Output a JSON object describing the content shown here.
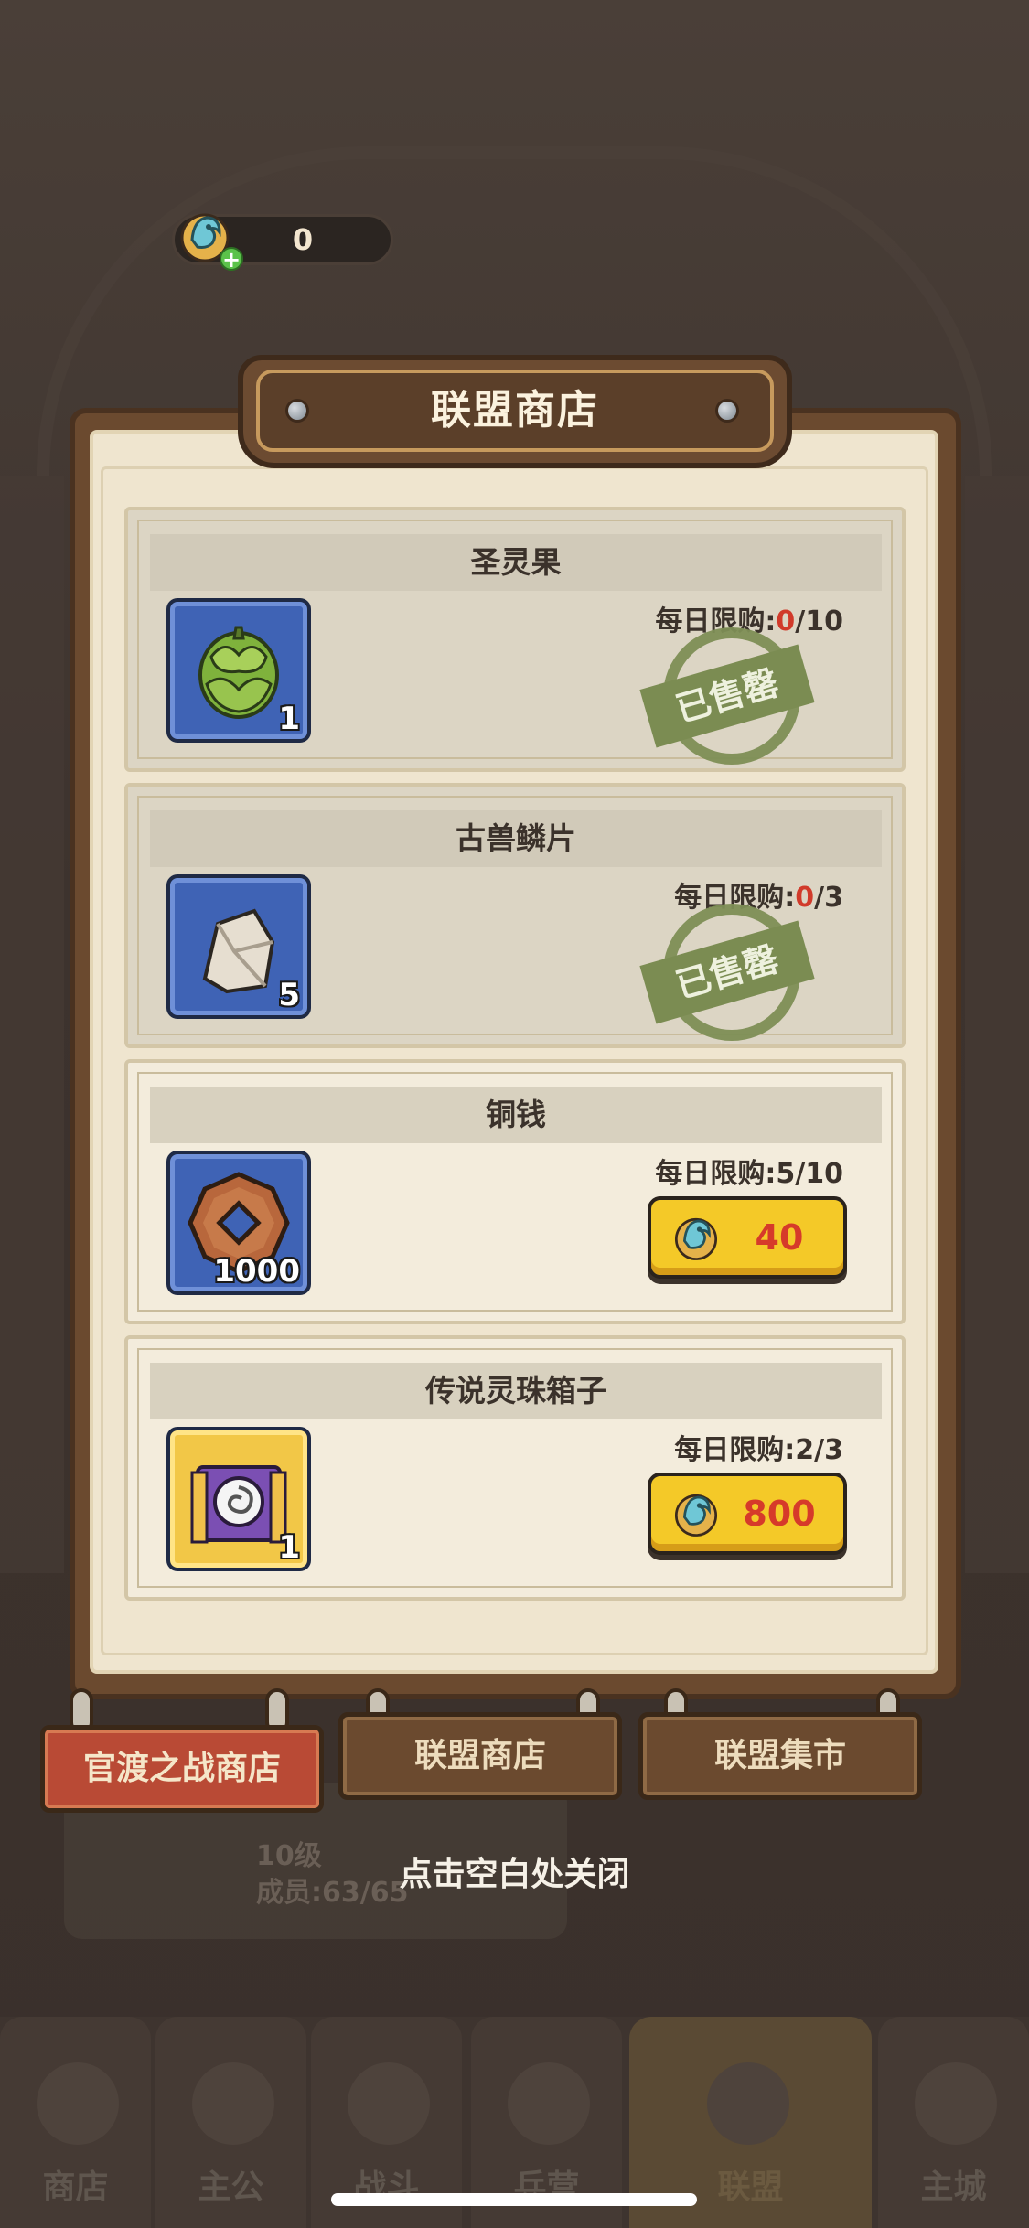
{
  "currency": {
    "value": "0",
    "icon": "dragon-coin-icon"
  },
  "panel": {
    "title": "联盟商店"
  },
  "items": [
    {
      "name": "圣灵果",
      "qty": "1",
      "limit_prefix": "每日限购:",
      "limit_bought": "0",
      "limit_total": "/10",
      "status": "已售罄",
      "icon": "spirit-fruit-icon"
    },
    {
      "name": "古兽鳞片",
      "qty": "5",
      "limit_prefix": "每日限购:",
      "limit_bought": "0",
      "limit_total": "/3",
      "status": "已售罄",
      "icon": "beast-scale-icon"
    },
    {
      "name": "铜钱",
      "qty": "1000",
      "limit": "每日限购:5/10",
      "price": "40",
      "icon": "copper-coin-icon"
    },
    {
      "name": "传说灵珠箱子",
      "qty": "1",
      "limit": "每日限购:2/3",
      "price": "800",
      "icon": "orb-chest-icon"
    }
  ],
  "tabs": [
    {
      "label": "官渡之战商店",
      "active": true
    },
    {
      "label": "联盟商店",
      "active": false
    },
    {
      "label": "联盟集市",
      "active": false
    }
  ],
  "close_hint": "点击空白处关闭",
  "background_guild": {
    "level": "10级",
    "members": "成员:63/65"
  },
  "bottom_nav": [
    {
      "label": "商店"
    },
    {
      "label": "主公"
    },
    {
      "label": "战斗"
    },
    {
      "label": "兵营"
    },
    {
      "label": "联盟",
      "active": true
    },
    {
      "label": "主城"
    }
  ],
  "colors": {
    "accent": "#f4c928",
    "price_red": "#d63a2a",
    "soldout_green": "#7b8c52",
    "panel_wood": "#6b4a2f",
    "active_tab": "#b94a35"
  }
}
